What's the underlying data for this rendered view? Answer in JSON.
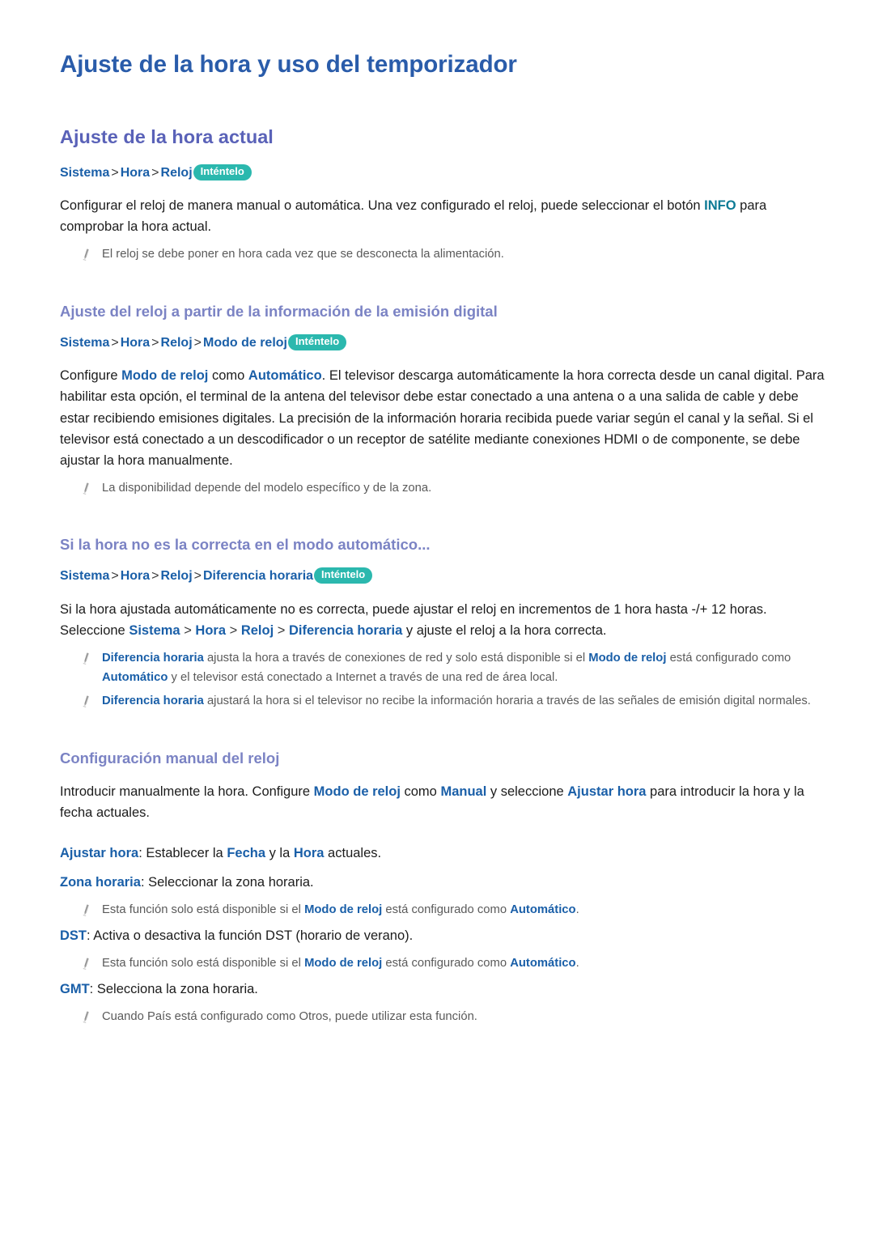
{
  "document": {
    "title": "Ajuste de la hora y uso del temporizador"
  },
  "colors": {
    "h1": "#2a5caa",
    "h2": "#5a62b8",
    "h3": "#7b83c4",
    "keyword_blue": "#1a5fa8",
    "keyword_teal": "#0b7a95",
    "badge_teal": "#2bb8ae",
    "note_text": "#5a5a5a",
    "body_text": "#1c1c1c"
  },
  "badge_label": "Inténtelo",
  "icons": {
    "note": "pencil-icon"
  },
  "sections": [
    {
      "heading": "Ajuste de la hora actual",
      "breadcrumb": {
        "parts": [
          "Sistema",
          "Hora",
          "Reloj"
        ],
        "separator": ">",
        "badge": "Inténtelo",
        "full": "Sistema > Hora > Reloj"
      },
      "paragraph": {
        "pre": "Configurar el reloj de manera manual o automática. Una vez configurado el reloj, puede seleccionar el botón ",
        "keyword": "INFO",
        "post": " para comprobar la hora actual."
      },
      "notes": [
        "El reloj se debe poner en hora cada vez que se desconecta la alimentación."
      ]
    },
    {
      "heading": "Ajuste del reloj a partir de la información de la emisión digital",
      "breadcrumb": {
        "parts": [
          "Sistema",
          "Hora",
          "Reloj",
          "Modo de reloj"
        ],
        "separator": ">",
        "badge": "Inténtelo",
        "full": "Sistema > Hora > Reloj > Modo de reloj"
      },
      "paragraph": {
        "p1": "Configure ",
        "kw1": "Modo de reloj",
        "p2": " como ",
        "kw2": "Automático",
        "p3": ". El televisor descarga automáticamente la hora correcta desde un canal digital. Para habilitar esta opción, el terminal de la antena del televisor debe estar conectado a una antena o a una salida de cable y debe estar recibiendo emisiones digitales. La precisión de la información horaria recibida puede variar según el canal y la señal. Si el televisor está conectado a un descodificador o un receptor de satélite mediante conexiones HDMI o de componente, se debe ajustar la hora manualmente."
      },
      "notes": [
        "La disponibilidad depende del modelo específico y de la zona."
      ]
    },
    {
      "heading": "Si la hora no es la correcta en el modo automático...",
      "breadcrumb": {
        "parts": [
          "Sistema",
          "Hora",
          "Reloj",
          "Diferencia horaria"
        ],
        "separator": ">",
        "badge": "Inténtelo",
        "full": "Sistema > Hora > Reloj > Diferencia horaria"
      },
      "paragraph": {
        "p1": "Si la hora ajustada automáticamente no es correcta, puede ajustar el reloj en incrementos de 1 hora hasta -/+ 12 horas. Seleccione ",
        "kw1": "Sistema",
        "sep1": " > ",
        "kw2": "Hora",
        "sep2": " > ",
        "kw3": "Reloj",
        "sep3": " > ",
        "kw4": "Diferencia horaria",
        "p2": " y ajuste el reloj a la hora correcta."
      },
      "notes_rich": [
        {
          "kw1": "Diferencia horaria",
          "t1": " ajusta la hora a través de conexiones de red y solo está disponible si el ",
          "kw2": "Modo de reloj",
          "t2": " está configurado como ",
          "kw3": "Automático",
          "t3": " y el televisor está conectado a Internet a través de una red de área local."
        },
        {
          "kw1": "Diferencia horaria",
          "t1": " ajustará la hora si el televisor no recibe la información horaria a través de las señales de emisión digital normales.",
          "kw2": "",
          "t2": "",
          "kw3": "",
          "t3": ""
        }
      ]
    },
    {
      "heading": "Configuración manual del reloj",
      "paragraph": {
        "p1": "Introducir manualmente la hora. Configure ",
        "kw1": "Modo de reloj",
        "p2": " como ",
        "kw2": "Manual",
        "p3": " y seleccione ",
        "kw3": "Ajustar hora",
        "p4": " para introducir la hora y la fecha actuales."
      },
      "definitions": [
        {
          "term": "Ajustar hora",
          "d1": ": Establecer la ",
          "kw1": "Fecha",
          "d2": " y la ",
          "kw2": "Hora",
          "d3": " actuales."
        },
        {
          "term": "Zona horaria",
          "d1": ": Seleccionar la zona horaria.",
          "kw1": "",
          "d2": "",
          "kw2": "",
          "d3": ""
        },
        {
          "term": "DST",
          "d1": ": Activa o desactiva la función DST (horario de verano).",
          "kw1": "",
          "d2": "",
          "kw2": "",
          "d3": ""
        },
        {
          "term": "GMT",
          "d1": ": Selecciona la zona horaria.",
          "kw1": "",
          "d2": "",
          "kw2": "",
          "d3": ""
        }
      ],
      "note_availability": {
        "t1": "Esta función solo está disponible si el ",
        "kw1": "Modo de reloj",
        "t2": " está configurado como ",
        "kw2": "Automático",
        "t3": "."
      },
      "note_country": "Cuando País está configurado como Otros, puede utilizar esta función."
    }
  ]
}
